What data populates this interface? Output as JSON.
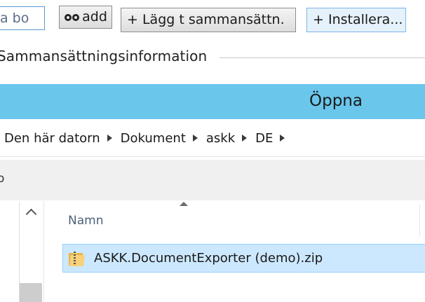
{
  "toolbar": {
    "search_fragment": "a bo",
    "add_label": "add",
    "add_icon": "binoculars-icon",
    "lagg_label": "+ Lägg t sammansättn.",
    "install_label": "+ Installera..."
  },
  "group": {
    "title": "Sammansättningsinformation"
  },
  "dialog": {
    "title": "Öppna",
    "accent_color": "#6bc6ec"
  },
  "breadcrumb": {
    "items": [
      "Den här datorn",
      "Dokument",
      "askk",
      "DE"
    ]
  },
  "command_bar": {
    "fragment": "o"
  },
  "file_list": {
    "column_header": "Namn",
    "files": [
      {
        "name": "ASKK.DocumentExporter (demo).zip",
        "icon": "zip-folder-icon",
        "selected": true
      }
    ]
  }
}
